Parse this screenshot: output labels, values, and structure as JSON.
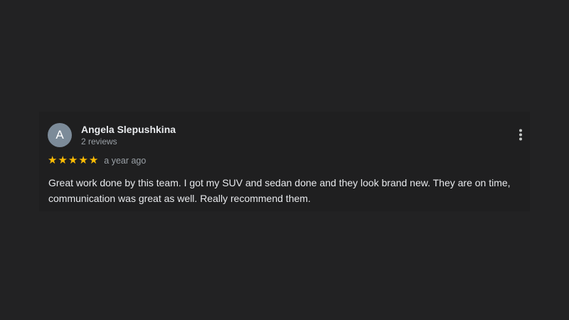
{
  "review": {
    "author": {
      "initial": "A",
      "name": "Angela Slepushkina",
      "reviews_count": "2 reviews",
      "avatar_color": "#7c8b99"
    },
    "rating": {
      "stars": 5,
      "max": 5,
      "star_color": "#fbbc04"
    },
    "date": "a year ago",
    "text": "Great work done by this team. I got my SUV and sedan done and they look brand new. They are on time, communication was great as well. Really recommend them.",
    "menu_icon": "more-vert-icon"
  }
}
